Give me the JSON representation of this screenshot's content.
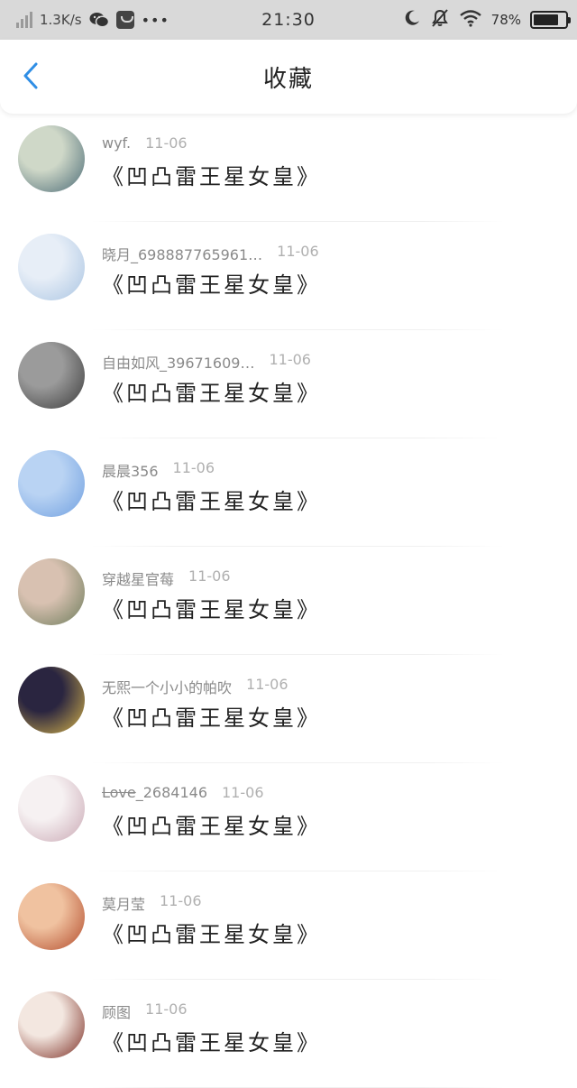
{
  "status_bar": {
    "network_speed": "1.3K/s",
    "time": "21:30",
    "battery": "78%",
    "battery_level": 0.78,
    "overflow": "•••"
  },
  "nav": {
    "title": "收藏",
    "back_icon": "chevron-left-icon"
  },
  "items": [
    {
      "user": "wyf.",
      "date": "11-06",
      "title": "《凹凸雷王星女皇》",
      "avatar_colors": [
        "#cfd8c8",
        "#4a6a75"
      ]
    },
    {
      "user": "晓月_698887765961…",
      "date": "11-06",
      "title": "《凹凸雷王星女皇》",
      "avatar_colors": [
        "#e7eef7",
        "#a9c4e2"
      ]
    },
    {
      "user": "自由如风_39671609…",
      "date": "11-06",
      "title": "《凹凸雷王星女皇》",
      "avatar_colors": [
        "#9b9b9b",
        "#3a3a3a"
      ]
    },
    {
      "user": "晨晨356",
      "date": "11-06",
      "title": "《凹凸雷王星女皇》",
      "avatar_colors": [
        "#b9d3f3",
        "#6f9fe0"
      ]
    },
    {
      "user": "穿越星官莓",
      "date": "11-06",
      "title": "《凹凸雷王星女皇》",
      "avatar_colors": [
        "#d8c1b1",
        "#6c7b5a"
      ]
    },
    {
      "user": "无熙一个小小的帕吹",
      "date": "11-06",
      "title": "《凹凸雷王星女皇》",
      "avatar_colors": [
        "#2a2540",
        "#d8b64b"
      ]
    },
    {
      "user_strike": "Love",
      "user": "_2684146",
      "date": "11-06",
      "title": "《凹凸雷王星女皇》",
      "avatar_colors": [
        "#f6f1f2",
        "#c9a7b3"
      ]
    },
    {
      "user": "莫月莹",
      "date": "11-06",
      "title": "《凹凸雷王星女皇》",
      "avatar_colors": [
        "#f0c2a0",
        "#b24a2a"
      ]
    },
    {
      "user": "顾图",
      "date": "11-06",
      "title": "《凹凸雷王星女皇》",
      "avatar_colors": [
        "#f3e7e0",
        "#7a2a20"
      ]
    }
  ]
}
